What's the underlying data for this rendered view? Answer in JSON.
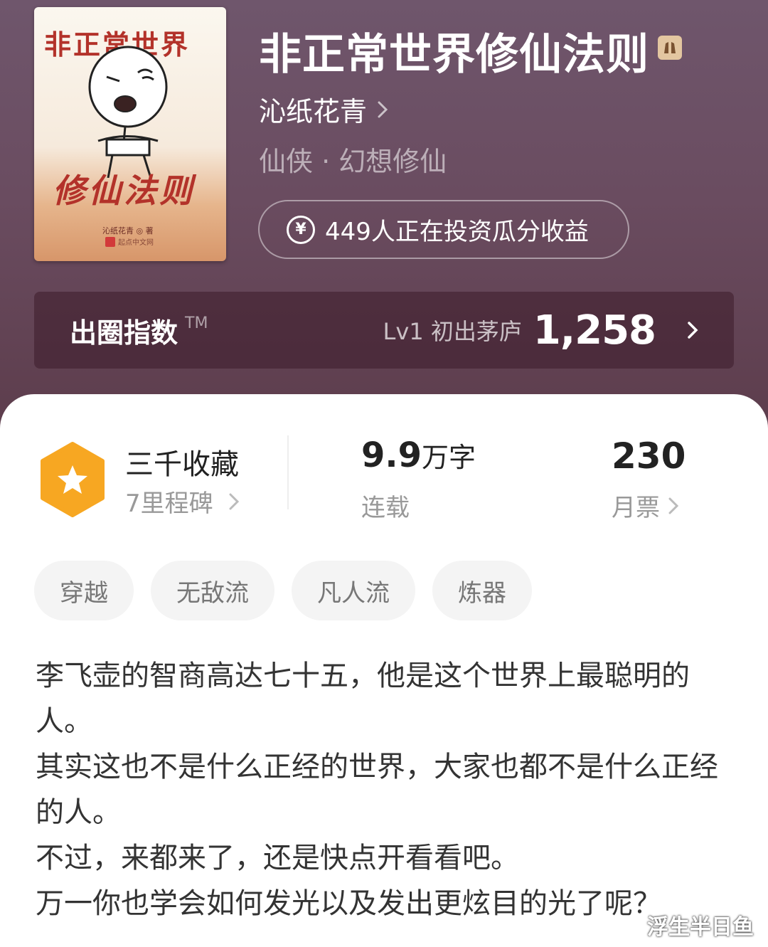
{
  "cover": {
    "title_top": "非正常世界",
    "title_bottom": "修仙法则",
    "author": "沁纸花青 ◎ 著",
    "publisher": "起点中文网"
  },
  "book": {
    "title": "非正常世界修仙法则",
    "author": "沁纸花青",
    "category": "仙侠 · 幻想修仙",
    "invest_text": "449人正在投资瓜分收益",
    "invest_icon": "¥"
  },
  "index": {
    "label": "出圈指数",
    "tm": "TM",
    "level": "Lv1 初出茅庐",
    "score": "1,258"
  },
  "stats": {
    "collect_title": "三千收藏",
    "collect_sub": "7里程碑",
    "words_num": "9.9",
    "words_unit": "万字",
    "status": "连载",
    "monthly_votes": "230",
    "monthly_label": "月票"
  },
  "tags": [
    "穿越",
    "无敌流",
    "凡人流",
    "炼器"
  ],
  "description": [
    "李飞壶的智商高达七十五，他是这个世界上最聪明的人。",
    "其实这也不是什么正经的世界，大家也都不是什么正经的人。",
    "不过，来都来了，还是快点开看看吧。",
    "万一你也学会如何发光以及发出更炫目的光了呢？"
  ],
  "watermark": "浮生半日鱼",
  "colors": {
    "header_top": "#6f566c",
    "header_bottom": "#5c3c4b",
    "badge_orange": "#f7a722",
    "cover_red": "#b3322a"
  }
}
